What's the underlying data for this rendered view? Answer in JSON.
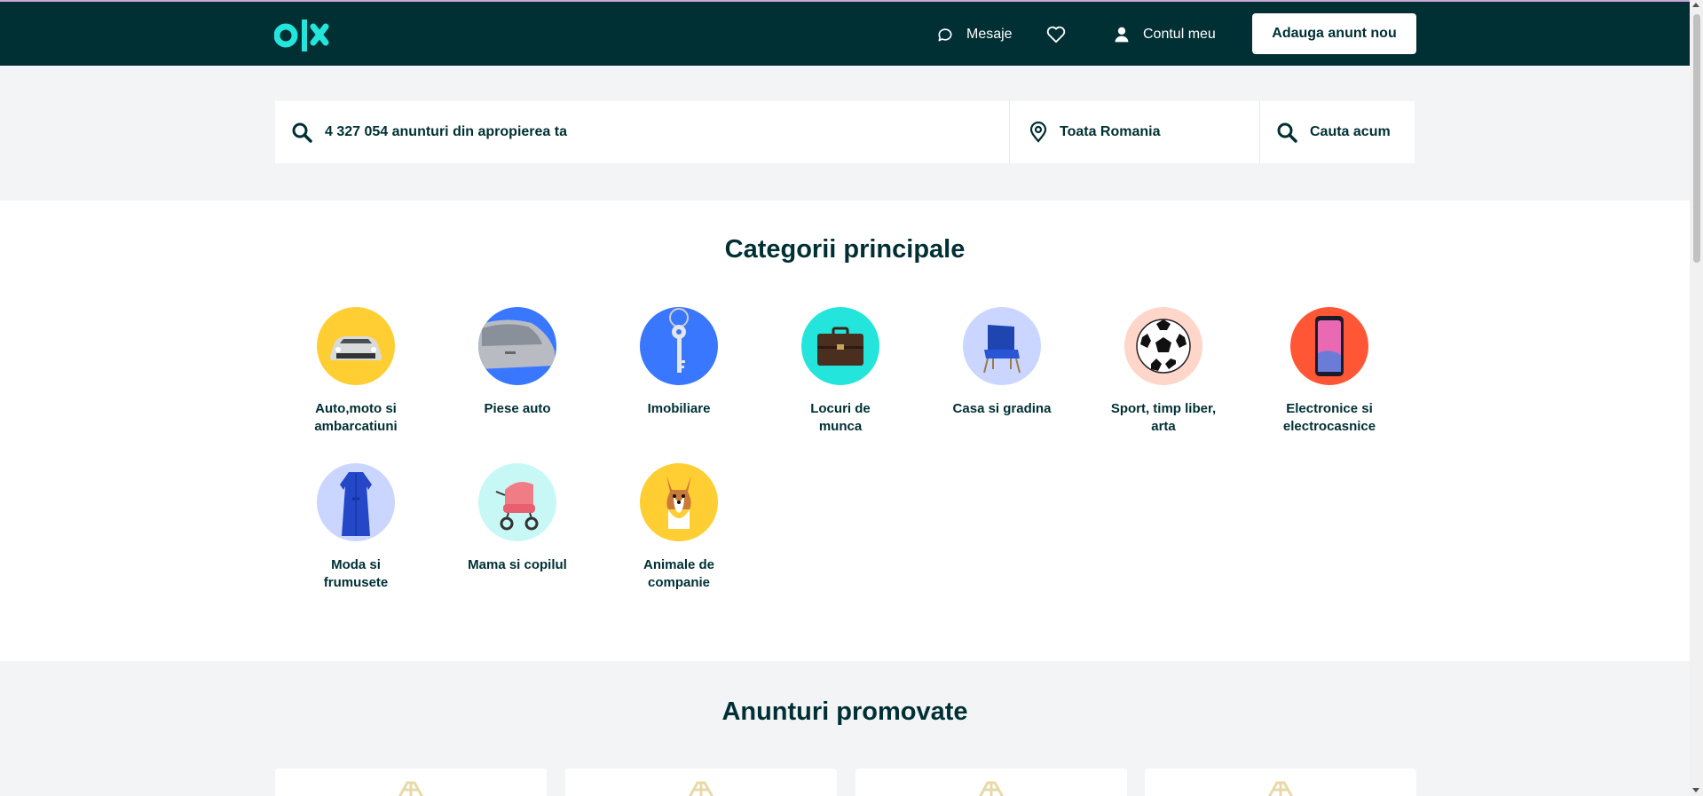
{
  "header": {
    "logo_text": "olx",
    "messages_label": "Mesaje",
    "favorites_icon": "heart-icon",
    "account_label": "Contul meu",
    "add_button_label": "Adauga anunt nou"
  },
  "search": {
    "query_text": "4 327 054 anunturi din apropierea ta",
    "location_text": "Toata Romania",
    "submit_label": "Cauta acum"
  },
  "categories": {
    "title": "Categorii principale",
    "items": [
      {
        "label": "Auto,moto si ambarcatiuni",
        "color": "#ffce32",
        "icon": "car-icon"
      },
      {
        "label": "Piese auto",
        "color": "#3a77ff",
        "icon": "car-door-icon"
      },
      {
        "label": "Imobiliare",
        "color": "#3a77ff",
        "icon": "key-icon"
      },
      {
        "label": "Locuri de munca",
        "color": "#23e5db",
        "icon": "briefcase-icon"
      },
      {
        "label": "Casa si gradina",
        "color": "#cad6ff",
        "icon": "armchair-icon"
      },
      {
        "label": "Sport, timp liber, arta",
        "color": "#ffd6c9",
        "icon": "soccer-ball-icon"
      },
      {
        "label": "Electronice si electrocasnice",
        "color": "#ff5636",
        "icon": "phone-icon"
      },
      {
        "label": "Moda si frumusete",
        "color": "#cad6ff",
        "icon": "dress-icon"
      },
      {
        "label": "Mama si copilul",
        "color": "#c8f8f6",
        "icon": "stroller-icon"
      },
      {
        "label": "Animale de companie",
        "color": "#ffce32",
        "icon": "dog-icon"
      }
    ]
  },
  "promoted": {
    "title": "Anunturi promovate"
  },
  "colors": {
    "brand_dark": "#002f34",
    "accent": "#23e5db",
    "background": "#f2f4f5"
  }
}
